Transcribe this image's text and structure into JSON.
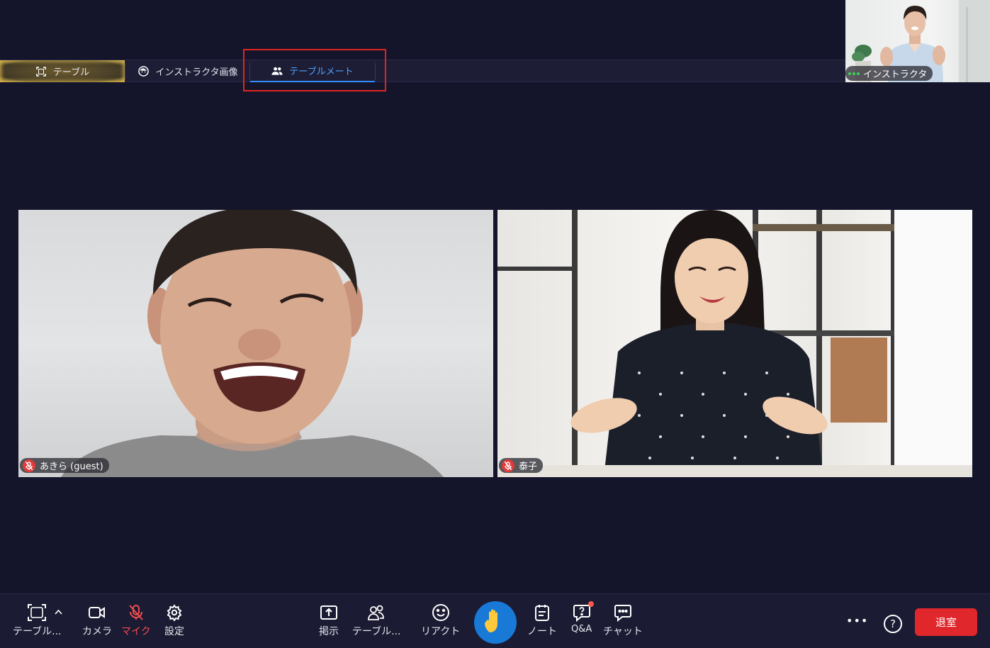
{
  "tabs": [
    {
      "label": "テーブル",
      "icon": "focus-frame-icon"
    },
    {
      "label": "インストラクタ画像",
      "icon": "face-icon"
    },
    {
      "label": "テーブルメート",
      "icon": "people-icon",
      "active": true
    }
  ],
  "instructor": {
    "name": "インストラクタ"
  },
  "participants": [
    {
      "name": "あきら (guest)",
      "mic": "muted"
    },
    {
      "name": "泰子",
      "mic": "muted"
    }
  ],
  "toolbar": {
    "table_label": "テーブル...",
    "camera_label": "カメラ",
    "mic_label": "マイク",
    "settings_label": "設定",
    "post_label": "掲示",
    "table2_label": "テーブル...",
    "reaction_label": "リアクト",
    "note_label": "ノート",
    "qa_label": "Q&A",
    "chat_label": "チャット",
    "more_label": "•••",
    "help_label": "?",
    "leave_label": "退室"
  },
  "colors": {
    "background": "#14142b",
    "active_tab": "#2f8fff",
    "mic_muted": "#ef4e4e",
    "leave_button": "#e0272c",
    "raise_hand": "#1879d6"
  }
}
